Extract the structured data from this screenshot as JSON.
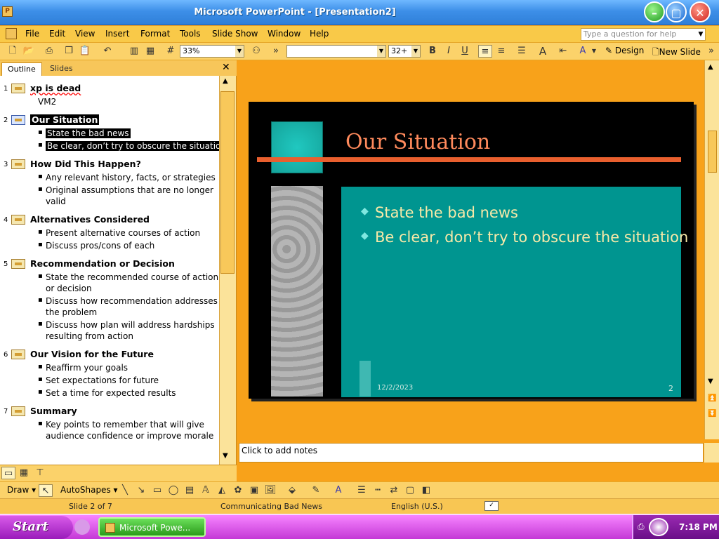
{
  "window": {
    "title": "Microsoft PowerPoint - [Presentation2]",
    "app_icon": "powerpoint-icon"
  },
  "menubar": {
    "items": [
      "File",
      "Edit",
      "View",
      "Insert",
      "Format",
      "Tools",
      "Slide Show",
      "Window",
      "Help"
    ],
    "help_placeholder": "Type a question for help"
  },
  "toolbar": {
    "zoom": "33%",
    "font_name": "",
    "font_size": "32+",
    "design_label": "Design",
    "new_slide_label": "New Slide"
  },
  "leftpane": {
    "tabs": [
      "Outline",
      "Slides"
    ],
    "outline": [
      {
        "num": "1",
        "title": "xp is dead",
        "subtitle": "VM2",
        "bullets": []
      },
      {
        "num": "2",
        "title": "Our Situation",
        "bullets": [
          "State the bad news",
          "Be clear, don’t try to obscure the situation"
        ]
      },
      {
        "num": "3",
        "title": "How Did This Happen?",
        "bullets": [
          "Any relevant history, facts, or strategies",
          "Original assumptions that are no longer",
          "valid"
        ]
      },
      {
        "num": "4",
        "title": "Alternatives Considered",
        "bullets": [
          "Present alternative courses of action",
          "Discuss pros/cons of each"
        ]
      },
      {
        "num": "5",
        "title": "Recommendation or Decision",
        "bullets": [
          "State the recommended course of action",
          "or decision",
          "Discuss how recommendation addresses",
          "the problem",
          "Discuss how plan will address hardships",
          "resulting from action"
        ]
      },
      {
        "num": "6",
        "title": "Our Vision for the Future",
        "bullets": [
          "Reaffirm your goals",
          "Set expectations for future",
          "Set a time for expected results"
        ]
      },
      {
        "num": "7",
        "title": "Summary",
        "bullets": [
          "Key points to remember that will give",
          "audience confidence or improve morale"
        ]
      }
    ]
  },
  "slide": {
    "title": "Our Situation",
    "bullets": [
      "State the bad news",
      "Be clear, don’t try to obscure the situation"
    ],
    "date": "12/2/2023",
    "page": "2"
  },
  "notes": {
    "placeholder": "Click to add notes"
  },
  "drawbar": {
    "draw_label": "Draw",
    "autoshapes_label": "AutoShapes"
  },
  "status": {
    "slide": "Slide 2 of 7",
    "design": "Communicating Bad News",
    "language": "English (U.S.)"
  },
  "taskbar": {
    "start_label": "Start",
    "task_label": "Microsoft Powe...",
    "clock": "7:18 PM"
  },
  "colors": {
    "accent": "#f8a21a",
    "slide_teal": "#009590",
    "slide_title": "#ff8a5c"
  }
}
